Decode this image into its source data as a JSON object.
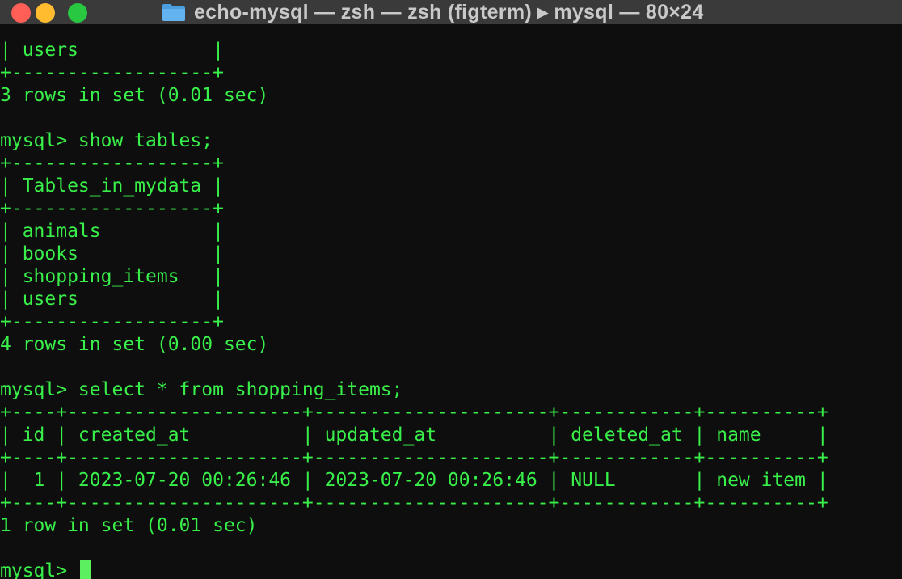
{
  "window": {
    "title": "echo-mysql — zsh — zsh (figterm) ▸ mysql — 80×24",
    "icon": "folder-icon",
    "colors": {
      "close": "#ff5f57",
      "minimize": "#febc2e",
      "maximize": "#28c840",
      "text": "#39f04a",
      "background": "#0e0e0e"
    }
  },
  "terminal": {
    "lines": [
      "| users            |",
      "+------------------+",
      "3 rows in set (0.01 sec)",
      "",
      "mysql> show tables;",
      "+------------------+",
      "| Tables_in_mydata |",
      "+------------------+",
      "| animals          |",
      "| books            |",
      "| shopping_items   |",
      "| users            |",
      "+------------------+",
      "4 rows in set (0.00 sec)",
      "",
      "mysql> select * from shopping_items;",
      "+----+---------------------+---------------------+------------+----------+",
      "| id | created_at          | updated_at          | deleted_at | name     |",
      "+----+---------------------+---------------------+------------+----------+",
      "|  1 | 2023-07-20 00:26:46 | 2023-07-20 00:26:46 | NULL       | new item |",
      "+----+---------------------+---------------------+------------+----------+",
      "1 row in set (0.01 sec)",
      ""
    ],
    "prompt": "mysql> "
  }
}
